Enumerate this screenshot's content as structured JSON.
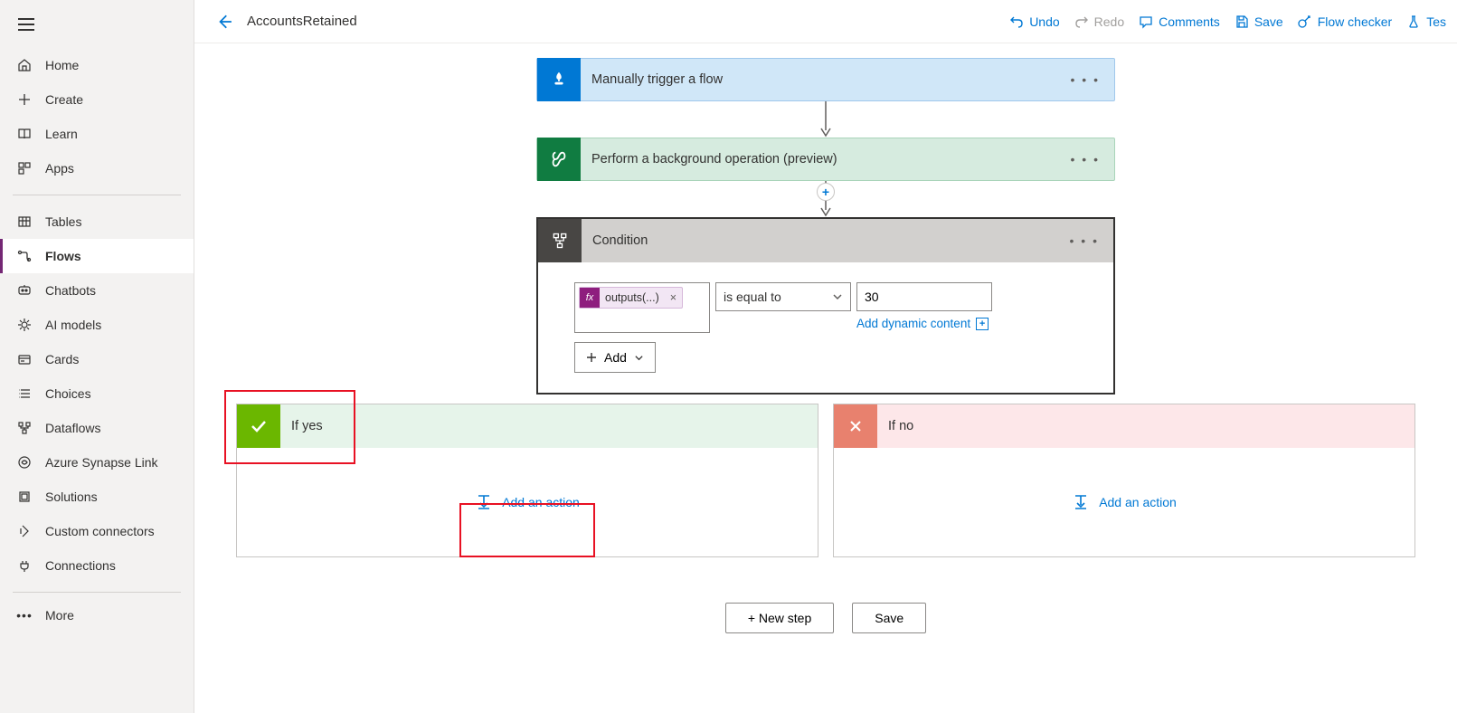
{
  "header": {
    "flow_name": "AccountsRetained",
    "actions": {
      "undo": "Undo",
      "redo": "Redo",
      "comments": "Comments",
      "save": "Save",
      "flow_checker": "Flow checker",
      "test": "Tes"
    }
  },
  "sidebar": {
    "items": [
      {
        "label": "Home"
      },
      {
        "label": "Create"
      },
      {
        "label": "Learn"
      },
      {
        "label": "Apps"
      },
      {
        "label": "Tables"
      },
      {
        "label": "Flows"
      },
      {
        "label": "Chatbots"
      },
      {
        "label": "AI models"
      },
      {
        "label": "Cards"
      },
      {
        "label": "Choices"
      },
      {
        "label": "Dataflows"
      },
      {
        "label": "Azure Synapse Link"
      },
      {
        "label": "Solutions"
      },
      {
        "label": "Custom connectors"
      },
      {
        "label": "Connections"
      },
      {
        "label": "More"
      }
    ]
  },
  "flow": {
    "trigger": {
      "title": "Manually trigger a flow"
    },
    "step1": {
      "title": "Perform a background operation (preview)"
    },
    "condition": {
      "title": "Condition",
      "expression_token": "outputs(...)",
      "operator": "is equal to",
      "value": "30",
      "dynamic_link": "Add dynamic content",
      "add_button": "Add"
    },
    "branches": {
      "yes": {
        "title": "If yes",
        "add_action": "Add an action"
      },
      "no": {
        "title": "If no",
        "add_action": "Add an action"
      }
    }
  },
  "footer": {
    "new_step": "+ New step",
    "save": "Save"
  }
}
